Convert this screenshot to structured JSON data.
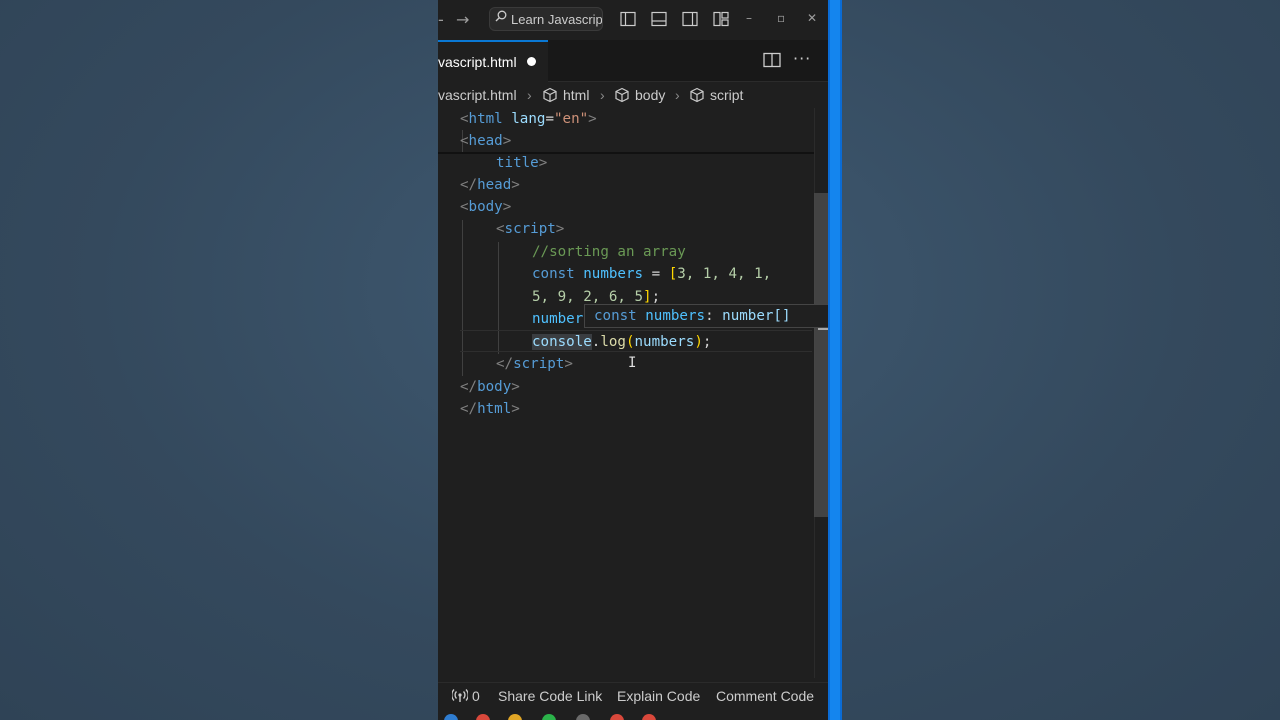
{
  "titlebar": {
    "search_text": "Learn Javascrip"
  },
  "tab": {
    "label": "vascript.html"
  },
  "breadcrumb": {
    "items": [
      "vascript.html",
      "html",
      "body",
      "script"
    ]
  },
  "code": {
    "html_open": {
      "tag": "html",
      "attr": "lang",
      "value": "\"en\""
    },
    "head_open": "head",
    "title_line": "title",
    "head_close": "head",
    "body_open": "body",
    "script_open": "script",
    "comment": "//sorting an array",
    "decl": {
      "kw": "const",
      "name": "numbers",
      "eq": " = ",
      "values_line1": "3, 1, 4, 1,",
      "values_line2": "5, 9, 2, 6, 5"
    },
    "partial_line": "number",
    "log_line": {
      "obj": "console",
      "method": "log",
      "arg": "numbers"
    },
    "script_close": "script",
    "body_close": "body",
    "html_close": "html"
  },
  "hover": {
    "kw": "const",
    "name": "numbers",
    "type": "number[]"
  },
  "statusbar": {
    "ports_count": "0",
    "share": "Share Code Link",
    "explain": "Explain Code",
    "comment": "Comment Code"
  },
  "colors": {
    "editor_bg": "#1f1f1f",
    "accent": "#0a78d4",
    "tag": "#569cd6",
    "string": "#ce9178",
    "comment": "#6a9955"
  }
}
